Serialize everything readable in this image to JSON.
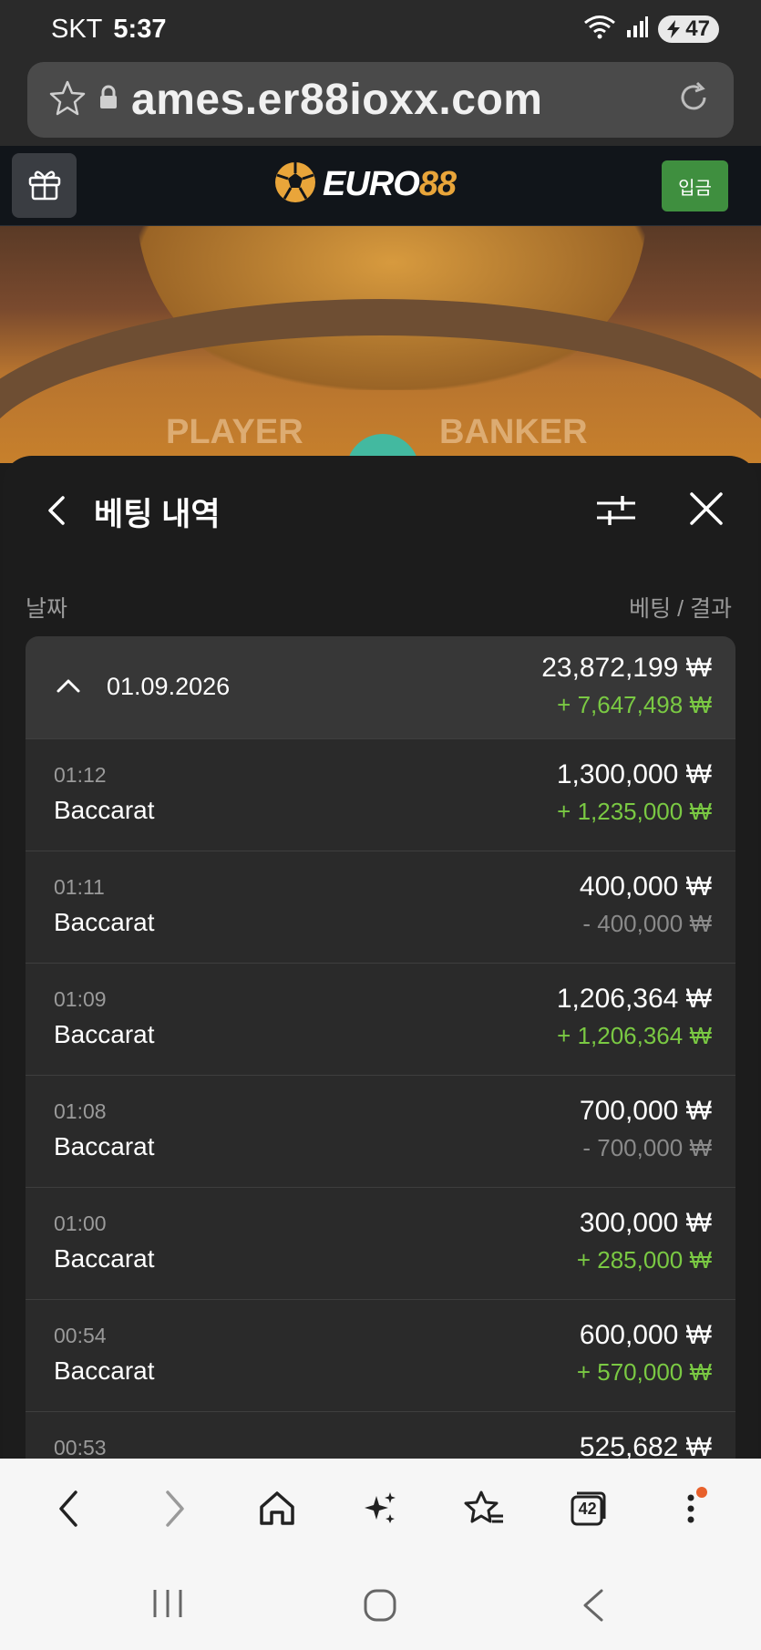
{
  "status": {
    "carrier": "SKT",
    "time": "5:37",
    "battery": "47"
  },
  "browser": {
    "url": "ames.er88ioxx.com",
    "tabs_count": "42"
  },
  "site": {
    "logo_primary": "EURO",
    "logo_accent": "88",
    "deposit_label": "입금"
  },
  "game_bg": {
    "player_label": "PLAYER",
    "banker_label": "BANKER"
  },
  "sheet": {
    "title": "베팅 내역",
    "col_date": "날짜",
    "col_bet_result": "베팅 / 결과",
    "group": {
      "date": "01.09.2026",
      "bet": "23,872,199 ₩",
      "result": "+ 7,647,498 ₩"
    },
    "rows": [
      {
        "time": "01:12",
        "game": "Baccarat",
        "bet": "1,300,000 ₩",
        "result": "+ 1,235,000 ₩"
      },
      {
        "time": "01:11",
        "game": "Baccarat",
        "bet": "400,000 ₩",
        "result": "- 400,000 ₩"
      },
      {
        "time": "01:09",
        "game": "Baccarat",
        "bet": "1,206,364 ₩",
        "result": "+ 1,206,364 ₩"
      },
      {
        "time": "01:08",
        "game": "Baccarat",
        "bet": "700,000 ₩",
        "result": "- 700,000 ₩"
      },
      {
        "time": "01:00",
        "game": "Baccarat",
        "bet": "300,000 ₩",
        "result": "+ 285,000 ₩"
      },
      {
        "time": "00:54",
        "game": "Baccarat",
        "bet": "600,000 ₩",
        "result": "+ 570,000 ₩"
      },
      {
        "time": "00:53",
        "game": "",
        "bet": "525,682 ₩",
        "result": ""
      }
    ]
  },
  "colors": {
    "win": "#7ac943",
    "loss": "#8a8a8a",
    "deposit": "#3f8f3f",
    "brand_accent": "#e9a53a",
    "notification": "#e8612c"
  },
  "icons": [
    "wifi-icon",
    "signal-icon",
    "star-icon",
    "lock-icon",
    "reload-icon",
    "gift-icon",
    "soccer-ball-icon",
    "back-chevron-icon",
    "filter-sliders-icon",
    "close-icon",
    "chevron-up-icon",
    "nav-back-icon",
    "nav-forward-icon",
    "home-icon",
    "sparkle-icon",
    "bookmarks-icon",
    "tabs-icon",
    "more-icon",
    "recents-icon",
    "home-circle-icon",
    "system-back-icon"
  ]
}
